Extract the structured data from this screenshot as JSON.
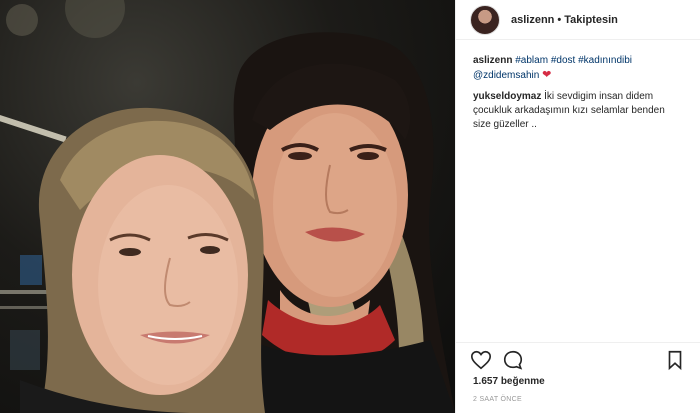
{
  "post": {
    "image_alt": "",
    "header": {
      "username": "aslizenn",
      "separator": "•",
      "follow_status": "Takiptesin"
    },
    "caption": {
      "username": "aslizenn",
      "hashtags": [
        "#ablam",
        "#dost",
        "#kadınındibi"
      ],
      "mention": "@zdidemsahin",
      "emoji": "❤"
    },
    "comment": {
      "username": "yukseldoymaz",
      "text": "İki sevdigim insan didem çocukluk arkadaşımın kızı selamlar benden size güzeller .."
    },
    "actions": {
      "like_icon": "heart-outline-icon",
      "comment_icon": "speech-bubble-icon",
      "save_icon": "bookmark-icon"
    },
    "likes": {
      "count": "1.657",
      "label": "beğenme"
    },
    "timestamp": "2 SAAT ÖNCE"
  },
  "colors": {
    "link": "#003569",
    "heart": "#d62d45",
    "muted": "#999999",
    "border": "#efefef"
  }
}
